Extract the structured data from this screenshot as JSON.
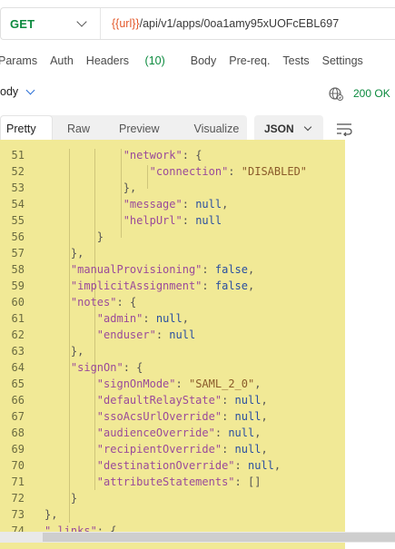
{
  "request": {
    "method": "GET",
    "url_variable": "{{url}}",
    "url_path": "/api/v1/apps/0oa1amy95xUOFcEBL697"
  },
  "request_tabs": {
    "params": "Params",
    "auth": "Auth",
    "headers": "Headers",
    "headers_count": "(10)",
    "body": "Body",
    "prereq": "Pre-req.",
    "tests": "Tests",
    "settings": "Settings"
  },
  "response": {
    "body_selector": "ody",
    "status": "200 OK"
  },
  "view_tabs": {
    "pretty": "Pretty",
    "raw": "Raw",
    "preview": "Preview",
    "visualize": "Visualize",
    "format": "JSON"
  },
  "code_lines": [
    {
      "n": "51",
      "t": "                \"network\": {"
    },
    {
      "n": "52",
      "t": "                    \"connection\": \"DISABLED\""
    },
    {
      "n": "53",
      "t": "                },"
    },
    {
      "n": "54",
      "t": "                \"message\": null,"
    },
    {
      "n": "55",
      "t": "                \"helpUrl\": null"
    },
    {
      "n": "56",
      "t": "            }"
    },
    {
      "n": "57",
      "t": "        },"
    },
    {
      "n": "58",
      "t": "        \"manualProvisioning\": false,"
    },
    {
      "n": "59",
      "t": "        \"implicitAssignment\": false,"
    },
    {
      "n": "60",
      "t": "        \"notes\": {"
    },
    {
      "n": "61",
      "t": "            \"admin\": null,"
    },
    {
      "n": "62",
      "t": "            \"enduser\": null"
    },
    {
      "n": "63",
      "t": "        },"
    },
    {
      "n": "64",
      "t": "        \"signOn\": {"
    },
    {
      "n": "65",
      "t": "            \"signOnMode\": \"SAML_2_0\","
    },
    {
      "n": "66",
      "t": "            \"defaultRelayState\": null,"
    },
    {
      "n": "67",
      "t": "            \"ssoAcsUrlOverride\": null,"
    },
    {
      "n": "68",
      "t": "            \"audienceOverride\": null,"
    },
    {
      "n": "69",
      "t": "            \"recipientOverride\": null,"
    },
    {
      "n": "70",
      "t": "            \"destinationOverride\": null,"
    },
    {
      "n": "71",
      "t": "            \"attributeStatements\": []"
    },
    {
      "n": "72",
      "t": "        }"
    },
    {
      "n": "73",
      "t": "    },"
    },
    {
      "n": "74",
      "t": "    \"_links\": {"
    }
  ],
  "icons": {
    "method_dropdown": "chevron-down-icon",
    "body_dropdown": "chevron-down-icon",
    "network": "globe-icon",
    "format_dropdown": "chevron-down-icon",
    "wrap": "wrap-lines-icon"
  },
  "colors": {
    "method": "#0b8a3e",
    "url_variable": "#e3582a",
    "status_ok": "#0b8a3e",
    "code_highlight": "#f1e996"
  }
}
